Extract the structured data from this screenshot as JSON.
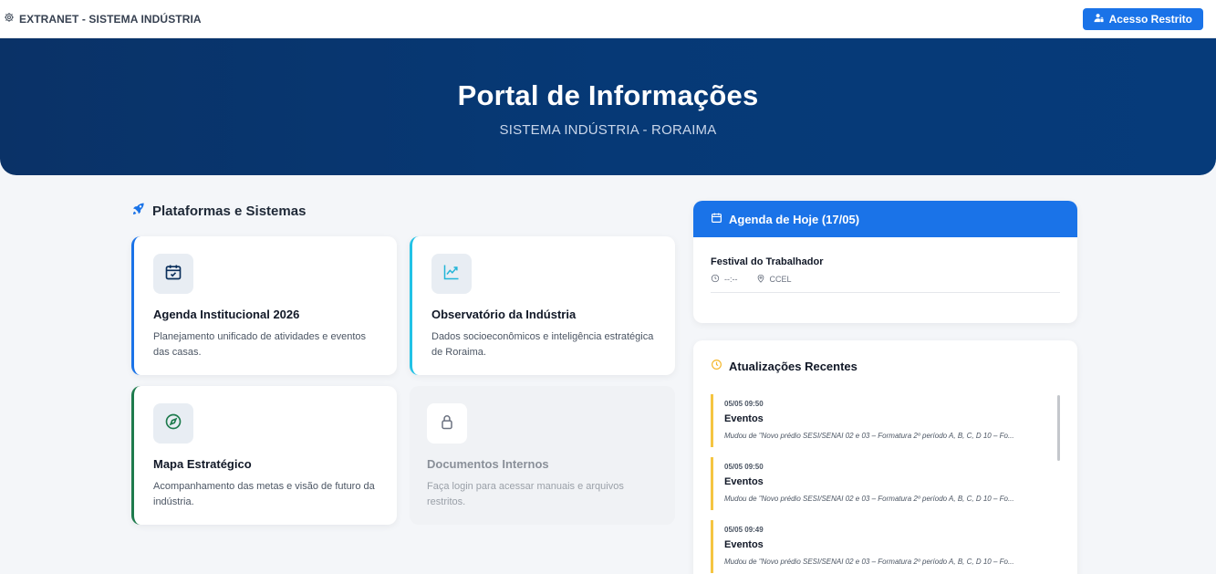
{
  "topbar": {
    "brand": "EXTRANET - SISTEMA INDÚSTRIA",
    "access_button": "Acesso Restrito"
  },
  "hero": {
    "title": "Portal de Informações",
    "subtitle": "SISTEMA INDÚSTRIA - RORAIMA"
  },
  "platforms": {
    "title": "Plataformas e Sistemas",
    "cards": [
      {
        "title": "Agenda Institucional 2026",
        "desc": "Planejamento unificado de atividades e eventos das casas.",
        "icon": "calendar-check-icon",
        "accent": "#1a73e8"
      },
      {
        "title": "Observatório da Indústria",
        "desc": "Dados socioeconômicos e inteligência estratégica de Roraima.",
        "icon": "chart-line-icon",
        "accent": "#22c2e6"
      },
      {
        "title": "Mapa Estratégico",
        "desc": "Acompanhamento das metas e visão de futuro da indústria.",
        "icon": "compass-icon",
        "accent": "#1e7b4d"
      },
      {
        "title": "Documentos Internos",
        "desc": "Faça login para acessar manuais e arquivos restritos.",
        "icon": "lock-icon",
        "accent": "#8a9099"
      }
    ]
  },
  "agenda": {
    "title": "Agenda de Hoje (17/05)",
    "events": [
      {
        "title": "Festival do Trabalhador",
        "time": "--:--",
        "location": "CCEL"
      }
    ]
  },
  "updates": {
    "title": "Atualizações Recentes",
    "items": [
      {
        "timestamp": "05/05 09:50",
        "title": "Eventos",
        "desc": "Mudou de \"Novo prédio SESI/SENAI 02 e 03 – Formatura 2º período A, B, C, D 10 – Fo..."
      },
      {
        "timestamp": "05/05 09:50",
        "title": "Eventos",
        "desc": "Mudou de \"Novo prédio SESI/SENAI 02 e 03 – Formatura 2º período A, B, C, D 10 – Fo..."
      },
      {
        "timestamp": "05/05 09:49",
        "title": "Eventos",
        "desc": "Mudou de \"Novo prédio SESI/SENAI 02 e 03 – Formatura 2º período A, B, C, D 10 – Fo..."
      }
    ]
  },
  "colors": {
    "primary": "#1a73e8",
    "hero": "#063976",
    "update_accent": "#f5c542"
  }
}
